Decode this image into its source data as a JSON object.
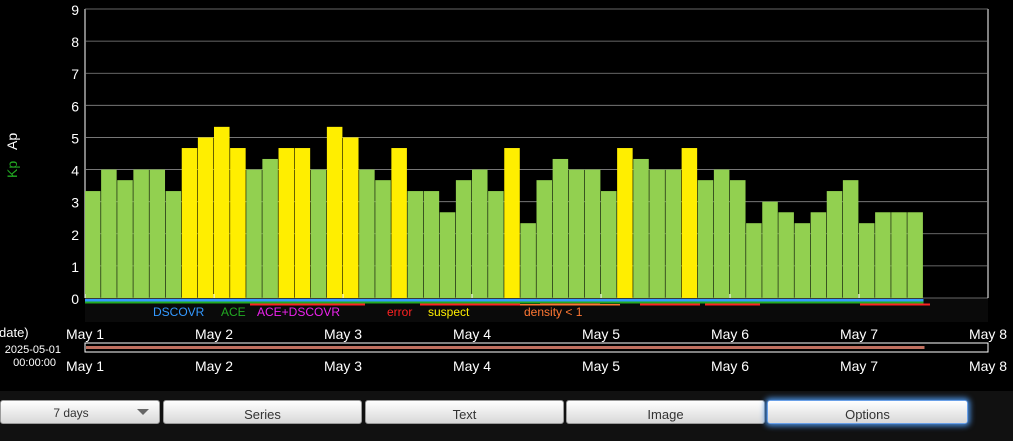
{
  "chart_data": {
    "type": "bar",
    "ylabel_kp": "Kp",
    "ylabel_ap": "Ap",
    "ylim": [
      0,
      9
    ],
    "yticks": [
      "0",
      "1",
      "2",
      "3",
      "4",
      "5",
      "6",
      "7",
      "8",
      "9"
    ],
    "x_range": [
      "2025-05-01",
      "2025-05-08"
    ],
    "interval_hours": 3,
    "xticks": [
      "May 1",
      "May 2",
      "May 3",
      "May 4",
      "May 5",
      "May 6",
      "May 7",
      "May 8"
    ],
    "values": [
      3.33,
      4.0,
      3.67,
      4.0,
      4.0,
      3.33,
      4.67,
      5.0,
      5.33,
      4.67,
      4.0,
      4.33,
      4.67,
      4.67,
      4.0,
      5.33,
      5.0,
      4.0,
      3.67,
      4.67,
      3.33,
      3.33,
      2.67,
      3.67,
      4.0,
      3.33,
      4.67,
      2.33,
      3.67,
      4.33,
      4.0,
      4.0,
      3.33,
      4.67,
      4.33,
      4.0,
      4.0,
      4.67,
      3.67,
      4.0,
      3.67,
      2.33,
      3.0,
      2.67,
      2.33,
      2.67,
      3.33,
      3.67,
      2.33,
      2.67,
      2.67,
      2.67
    ],
    "storm_threshold": 4.5,
    "colors": {
      "normal": "#92d050",
      "active": "#ffee00",
      "background": "#000000",
      "grid": "#888888",
      "axis_text": "#ffffff",
      "kp_label": "#22aa22",
      "ap_label": "#ffffff",
      "timeline": "#c07060"
    },
    "legend": [
      {
        "label": "DSCOVR",
        "color": "#3399ff"
      },
      {
        "label": "ACE",
        "color": "#22aa22"
      },
      {
        "label": "ACE+DSCOVR",
        "color": "#ee22ee"
      },
      {
        "label": "error",
        "color": "#ff2222"
      },
      {
        "label": "suspect",
        "color": "#ffee00"
      },
      {
        "label": "density < 1",
        "color": "#ff7733"
      }
    ],
    "axis_header": "date)",
    "start_date": "2025-05-01",
    "start_time": "00:00:00"
  },
  "toolbar": {
    "range_label": "7 days",
    "buttons": [
      "Series",
      "Text",
      "Image",
      "Options"
    ],
    "selected": "Options"
  }
}
